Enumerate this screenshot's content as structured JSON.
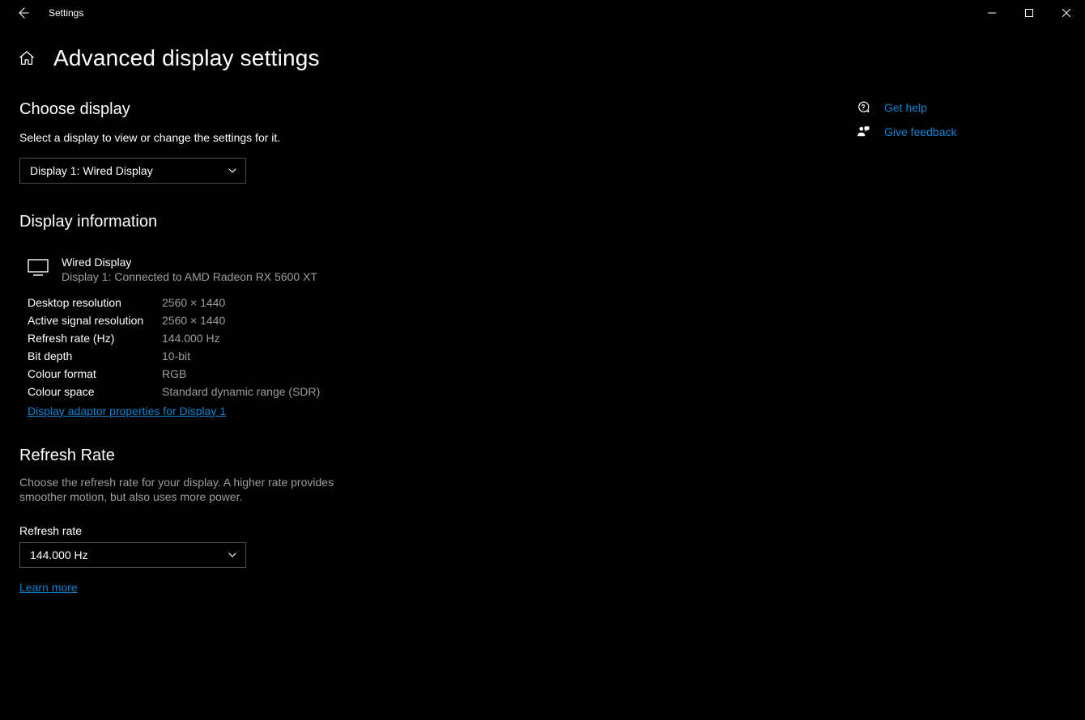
{
  "window": {
    "app_title": "Settings",
    "page_title": "Advanced display settings"
  },
  "choose_display": {
    "heading": "Choose display",
    "description": "Select a display to view or change the settings for it.",
    "selected": "Display 1: Wired Display"
  },
  "display_info": {
    "heading": "Display information",
    "name": "Wired Display",
    "connection": "Display 1: Connected to AMD Radeon RX 5600 XT",
    "rows": [
      {
        "label": "Desktop resolution",
        "value": "2560 × 1440"
      },
      {
        "label": "Active signal resolution",
        "value": "2560 × 1440"
      },
      {
        "label": "Refresh rate (Hz)",
        "value": "144.000 Hz"
      },
      {
        "label": "Bit depth",
        "value": "10-bit"
      },
      {
        "label": "Colour format",
        "value": "RGB"
      },
      {
        "label": "Colour space",
        "value": "Standard dynamic range (SDR)"
      }
    ],
    "adapter_link": "Display adaptor properties for Display 1"
  },
  "refresh_rate": {
    "heading": "Refresh Rate",
    "description": "Choose the refresh rate for your display. A higher rate provides smoother motion, but also uses more power.",
    "field_label": "Refresh rate",
    "selected": "144.000 Hz",
    "learn_more": "Learn more"
  },
  "side": {
    "help": "Get help",
    "feedback": "Give feedback"
  }
}
